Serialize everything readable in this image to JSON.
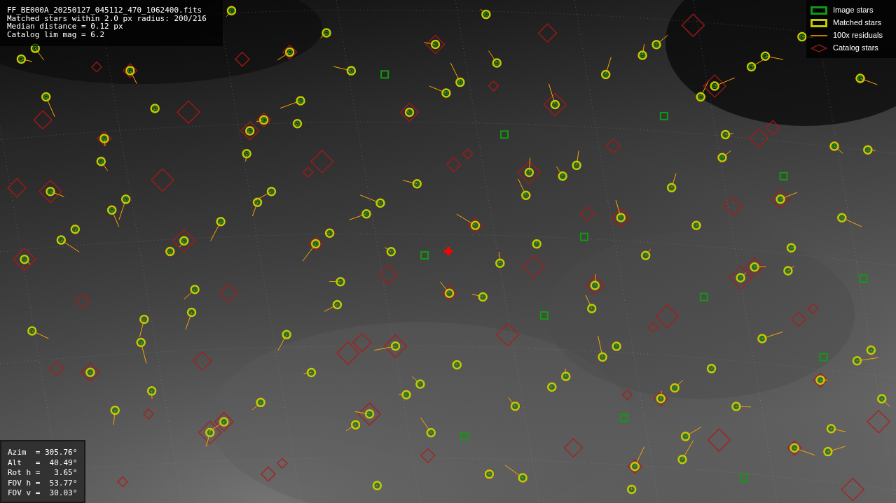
{
  "info_lines": [
    "FF_BE000A_20250127_045112_470_1062400.fits",
    "Matched stars within 2.0 px radius: 200/216",
    "Median distance = 0.12 px",
    "Catalog lim mag = 6.2"
  ],
  "legend": [
    {
      "kind": "image",
      "label": "Image stars"
    },
    {
      "kind": "matched",
      "label": "Matched stars"
    },
    {
      "kind": "residual",
      "label": "100x residuals"
    },
    {
      "kind": "catalog",
      "label": "Catalog stars"
    }
  ],
  "pointing": [
    "Azim  = 305.76°",
    "Alt   =  40.49°",
    "Rot h =   3.65°",
    "FOV h =  53.77°",
    "FOV v =  30.03°"
  ]
}
